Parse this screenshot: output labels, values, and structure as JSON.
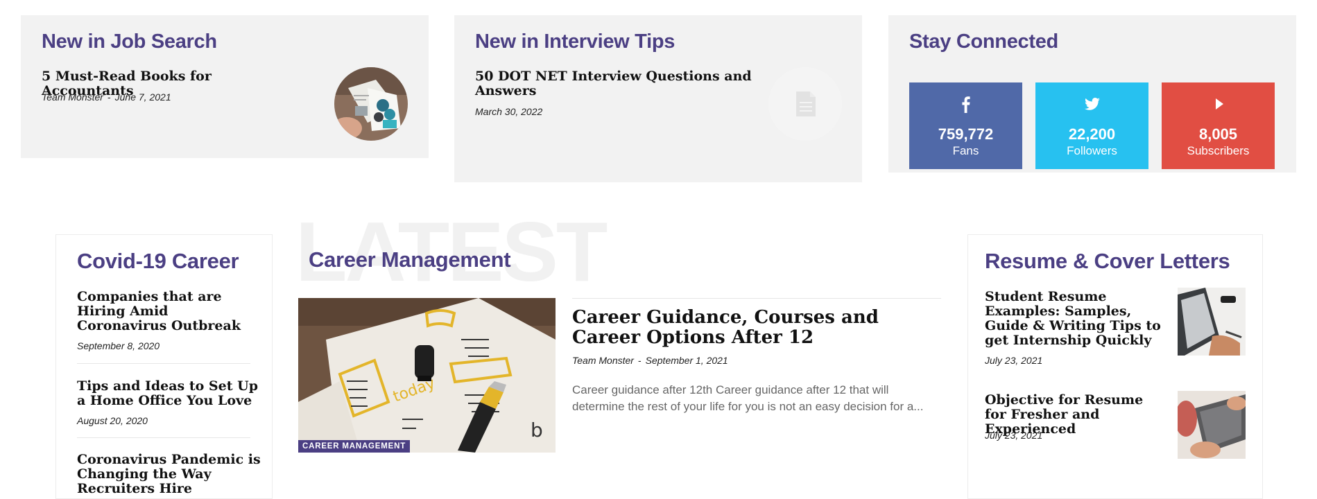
{
  "top": {
    "job_search": {
      "heading": "New in Job Search",
      "post_title": "5 Must-Read Books for Accountants",
      "author": "Team Monster",
      "date": "June 7, 2021"
    },
    "interview_tips": {
      "heading": "New in Interview Tips",
      "post_title": "50 DOT NET Interview Questions and Answers",
      "date": "March 30, 2022"
    },
    "stay_connected": {
      "heading": "Stay Connected",
      "facebook": {
        "count": "759,772",
        "label": "Fans",
        "color": "#5069a8",
        "icon": "facebook-icon"
      },
      "twitter": {
        "count": "22,200",
        "label": "Followers",
        "color": "#27c1f0",
        "icon": "twitter-icon"
      },
      "youtube": {
        "count": "8,005",
        "label": "Subscribers",
        "color": "#e14e43",
        "icon": "play-icon"
      }
    }
  },
  "covid": {
    "heading": "Covid-19 Career",
    "items": [
      {
        "title": "Companies that are Hiring Amid Coronavirus Outbreak",
        "date": "September 8, 2020"
      },
      {
        "title": "Tips and Ideas to Set Up a Home Office You Love",
        "date": "August 20, 2020"
      },
      {
        "title": "Coronavirus Pandemic is Changing the Way Recruiters Hire"
      }
    ]
  },
  "career": {
    "bg_text": "LATEST",
    "heading": "Career Management",
    "tag": "CAREER MANAGEMENT",
    "post_title": "Career Guidance, Courses and Career Options After 12",
    "author": "Team Monster",
    "date": "September 1, 2021",
    "excerpt": "Career guidance after 12th Career guidance after 12 that will determine the rest of your life for you is not an easy decision for a..."
  },
  "resume": {
    "heading": "Resume & Cover Letters",
    "items": [
      {
        "title": "Student Resume Examples: Samples, Guide & Writing Tips to get Internship Quickly",
        "date": "July 23, 2021"
      },
      {
        "title": "Objective for Resume for Fresher and Experienced",
        "date": "July 23, 2021"
      }
    ]
  },
  "colors": {
    "accent": "#4b3f83",
    "panel_bg": "#f2f2f2"
  }
}
